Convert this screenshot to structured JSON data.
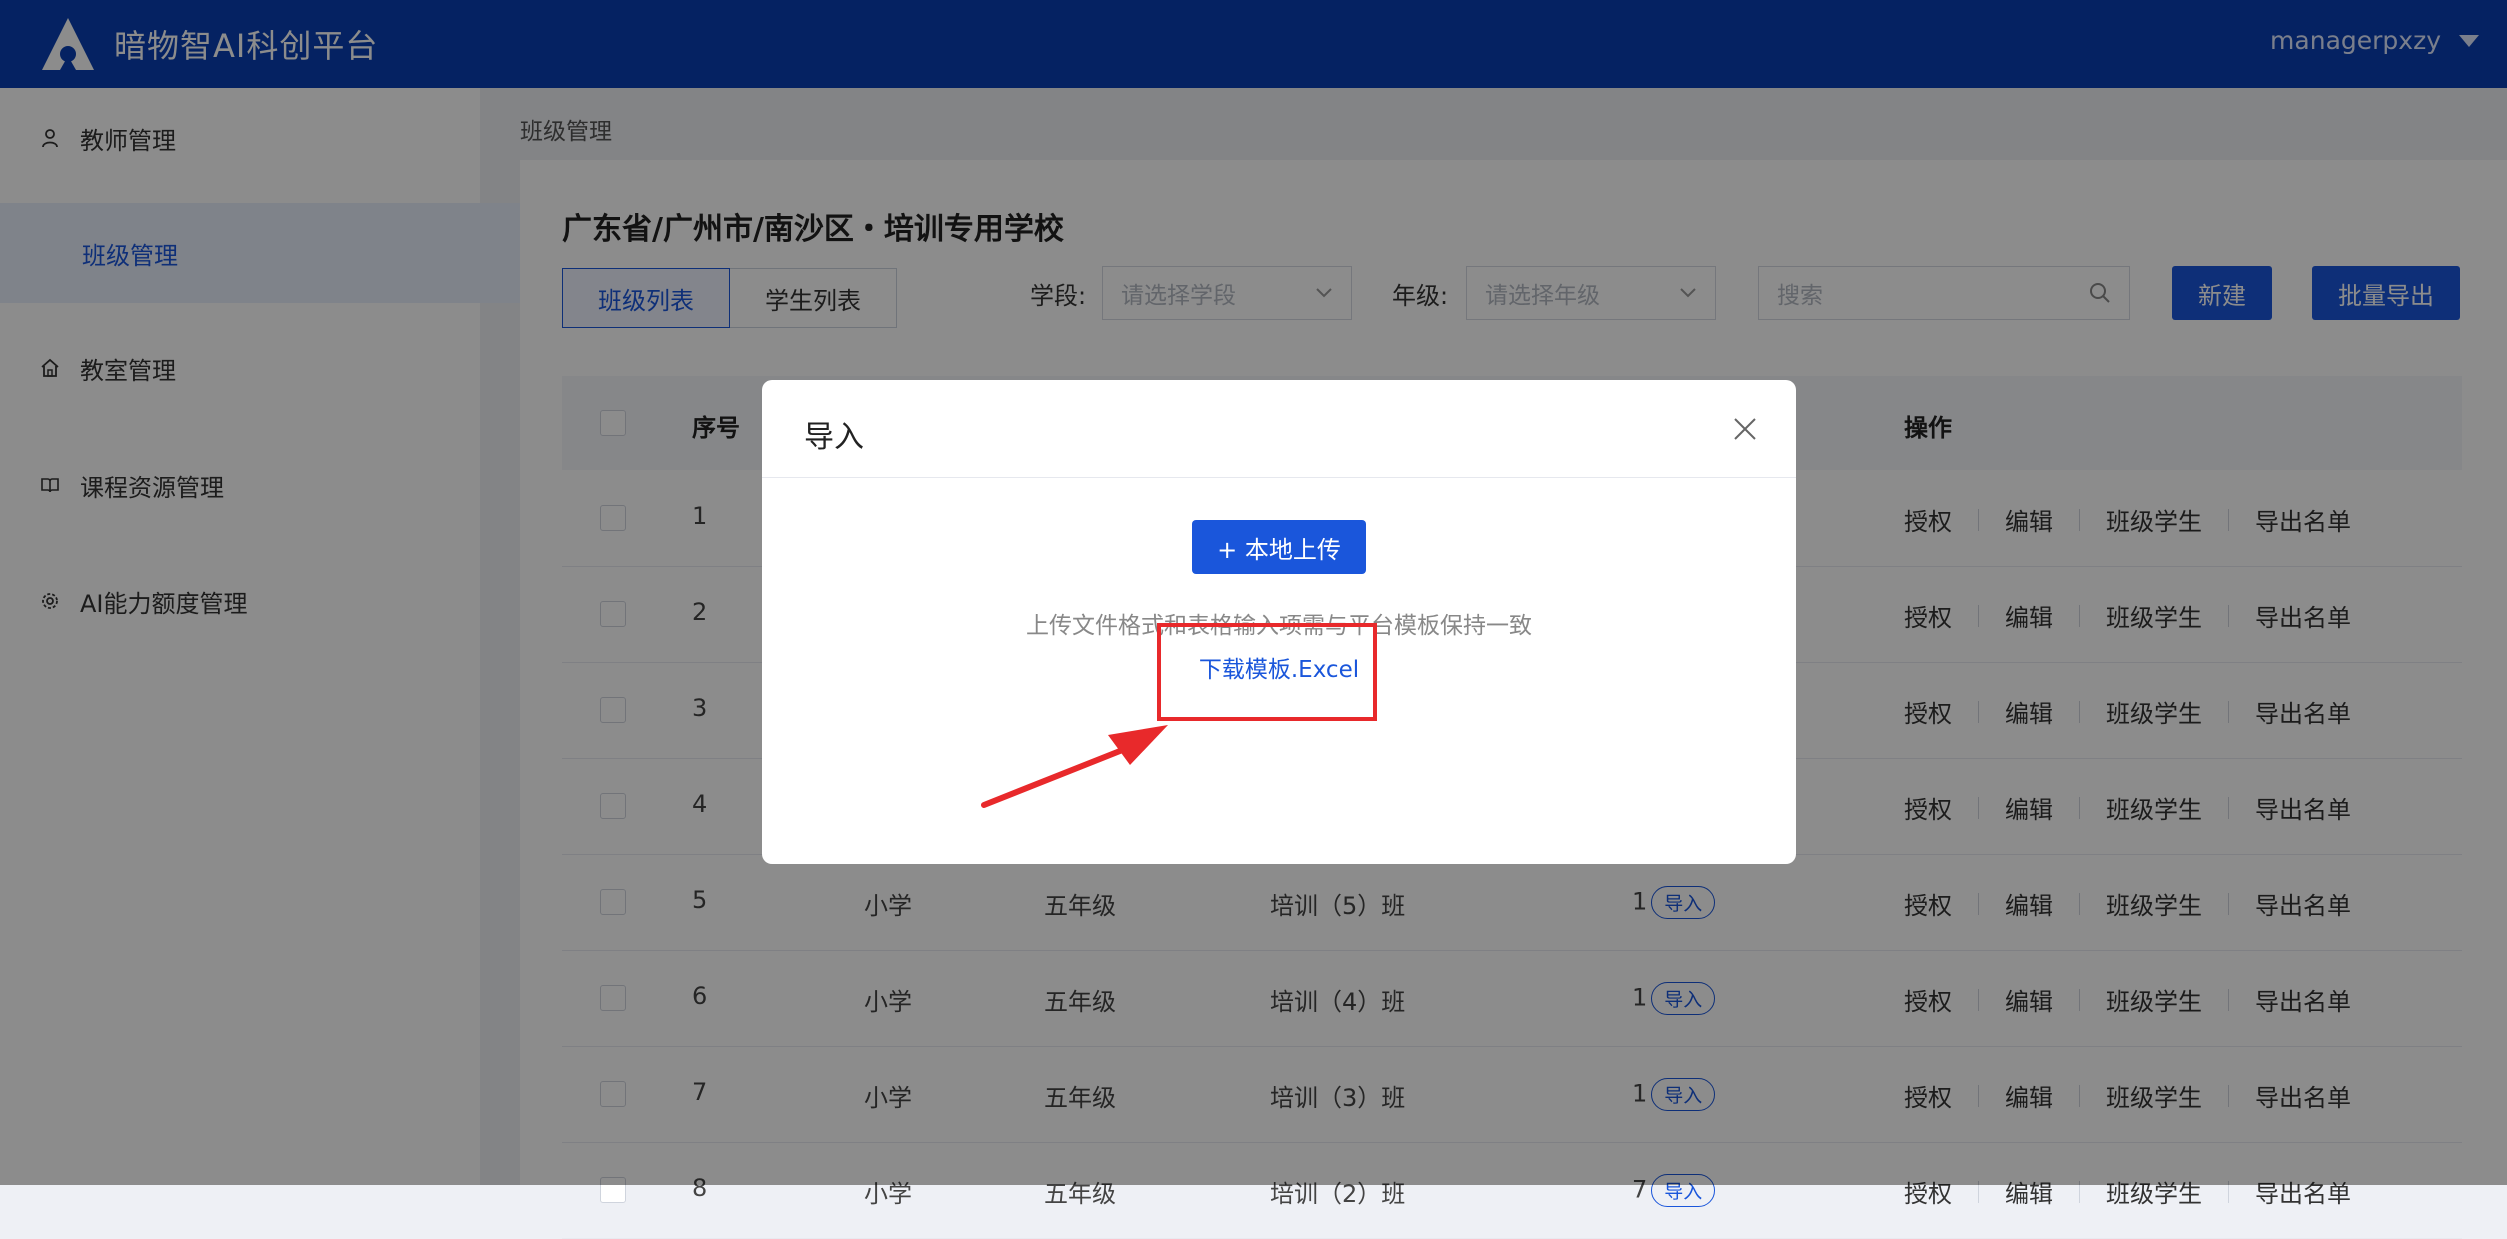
{
  "header": {
    "app_title": "暗物智AI科创平台",
    "username": "managerpxzy"
  },
  "sidebar": {
    "items": [
      {
        "label": "教师管理",
        "icon": "user-icon"
      },
      {
        "label": "班级管理",
        "icon": ""
      },
      {
        "label": "教室管理",
        "icon": "home-icon"
      },
      {
        "label": "课程资源管理",
        "icon": "book-icon"
      },
      {
        "label": "AI能力额度管理",
        "icon": "gear-icon"
      }
    ]
  },
  "breadcrumb": "班级管理",
  "main": {
    "school_title": "广东省/广州市/南沙区・培训专用学校",
    "tabs": [
      "班级列表",
      "学生列表"
    ],
    "filters": {
      "stage_label": "学段:",
      "stage_placeholder": "请选择学段",
      "grade_label": "年级:",
      "grade_placeholder": "请选择年级",
      "search_placeholder": "搜索"
    },
    "buttons": {
      "new": "新建",
      "export": "批量导出"
    },
    "table": {
      "headers": {
        "index": "序号",
        "ops": "操作"
      },
      "rows": [
        {
          "index": "1",
          "stage": "",
          "grade": "",
          "class": "",
          "count": "",
          "import": ""
        },
        {
          "index": "2",
          "stage": "",
          "grade": "",
          "class": "",
          "count": "",
          "import": ""
        },
        {
          "index": "3",
          "stage": "",
          "grade": "",
          "class": "",
          "count": "",
          "import": ""
        },
        {
          "index": "4",
          "stage": "",
          "grade": "",
          "class": "",
          "count": "",
          "import": ""
        },
        {
          "index": "5",
          "stage": "小学",
          "grade": "五年级",
          "class": "培训（5）班",
          "count": "1",
          "import": "导入"
        },
        {
          "index": "6",
          "stage": "小学",
          "grade": "五年级",
          "class": "培训（4）班",
          "count": "1",
          "import": "导入"
        },
        {
          "index": "7",
          "stage": "小学",
          "grade": "五年级",
          "class": "培训（3）班",
          "count": "1",
          "import": "导入"
        },
        {
          "index": "8",
          "stage": "小学",
          "grade": "五年级",
          "class": "培训（2）班",
          "count": "7",
          "import": "导入"
        }
      ],
      "ops": [
        "授权",
        "编辑",
        "班级学生",
        "导出名单"
      ]
    }
  },
  "modal": {
    "title": "导入",
    "upload_label": "+ 本地上传",
    "hint": "上传文件格式和表格输入项需与平台模板保持一致",
    "download_link": "下载模板.Excel"
  },
  "colors": {
    "primary": "#1a56db",
    "header": "#0a3fb3",
    "annotation": "#e8292b"
  }
}
